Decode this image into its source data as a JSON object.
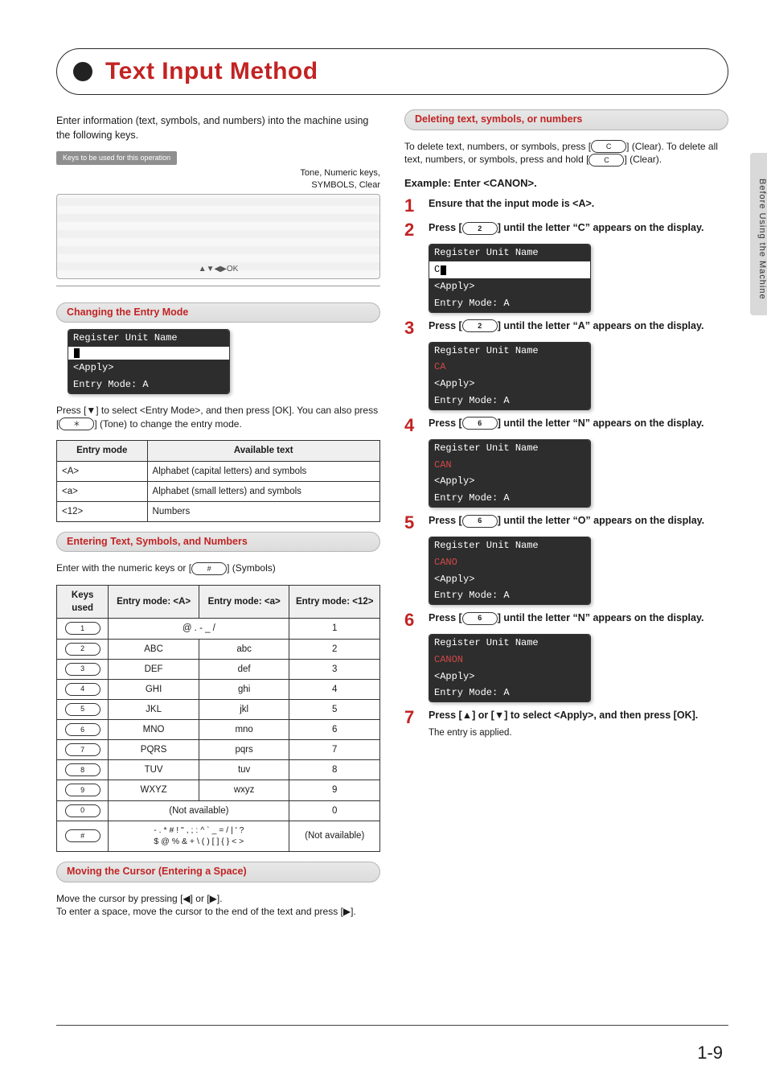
{
  "title": "Text Input Method",
  "sidetab": "Before Using the Machine",
  "pagenum": "1-9",
  "intro": "Enter information (text, symbols, and numbers) into the machine using the following keys.",
  "panel": {
    "tag": "Keys to be used for this operation",
    "small1": "Tone, Numeric keys,",
    "small2": "SYMBOLS, Clear",
    "nav": "▲▼◀▶OK"
  },
  "pill_change": "Changing the Entry Mode",
  "lcd_change": {
    "l1": "Register Unit Name",
    "l2_text": "",
    "l3": " <Apply>",
    "l4": "Entry Mode: A"
  },
  "change_note_a": "Press [▼] to select <Entry Mode>, and then press [OK]. You can also press [",
  "change_note_ast": "＊",
  "change_note_b": "] (Tone) to change the entry mode.",
  "entry_table": {
    "h1": "Entry mode",
    "h2": "Available text",
    "rows": [
      {
        "m": "<A>",
        "t": "Alphabet (capital letters) and symbols"
      },
      {
        "m": "<a>",
        "t": "Alphabet (small letters) and symbols"
      },
      {
        "m": "<12>",
        "t": "Numbers"
      }
    ]
  },
  "pill_enter": "Entering Text, Symbols, and Numbers",
  "enter_note_a": "Enter with the numeric keys or [",
  "enter_note_hash": "#",
  "enter_note_b": "] (Symbols)",
  "keypad_table": {
    "h_key": "Keys used",
    "h_A": "Entry mode: <A>",
    "h_a": "Entry mode: <a>",
    "h_12": "Entry mode: <12>",
    "rows": [
      {
        "key": "1",
        "colspan": true,
        "Aa": "@ . - _ /",
        "n": "1"
      },
      {
        "key": "2",
        "A": "ABC",
        "a": "abc",
        "n": "2"
      },
      {
        "key": "3",
        "A": "DEF",
        "a": "def",
        "n": "3"
      },
      {
        "key": "4",
        "A": "GHI",
        "a": "ghi",
        "n": "4"
      },
      {
        "key": "5",
        "A": "JKL",
        "a": "jkl",
        "n": "5"
      },
      {
        "key": "6",
        "A": "MNO",
        "a": "mno",
        "n": "6"
      },
      {
        "key": "7",
        "A": "PQRS",
        "a": "pqrs",
        "n": "7"
      },
      {
        "key": "8",
        "A": "TUV",
        "a": "tuv",
        "n": "8"
      },
      {
        "key": "9",
        "A": "WXYZ",
        "a": "wxyz",
        "n": "9"
      },
      {
        "key": "0",
        "colspan": true,
        "Aa": "(Not available)",
        "n": "0"
      },
      {
        "key": "#",
        "colspan": true,
        "Aa": "- . * # ! \" , ; : ^ ` _ = / | ' ?\n$ @ % & + \\ ( ) [ ] { } < >",
        "n": "(Not available)"
      }
    ]
  },
  "pill_cursor": "Moving the Cursor (Entering a Space)",
  "cursor_text": "Move the cursor by pressing [◀] or [▶].\nTo enter a space, move the cursor to the end of the text and press [▶].",
  "pill_delete": "Deleting text, symbols, or numbers",
  "delete_text_a": "To delete text, numbers, or symbols, press [",
  "delete_c": "C",
  "delete_text_b": "] (Clear). To delete all text, numbers, or symbols, press and hold [",
  "delete_text_c": "] (Clear).",
  "example_h": "Example: Enter <CANON>.",
  "steps": [
    {
      "n": "1",
      "text": "Ensure that the input mode is <A>."
    },
    {
      "n": "2",
      "text_a": "Press [",
      "key": "2",
      "text_b": "] until the letter “C” appears on the display.",
      "lcd": {
        "l1": "Register Unit Name",
        "l2": "C",
        "l3": " <Apply>",
        "l4": "Entry Mode: A"
      }
    },
    {
      "n": "3",
      "text_a": "Press [",
      "key": "2",
      "text_b": "] until the letter “A” appears on the display.",
      "lcd": {
        "l1": "Register Unit Name",
        "l2": "CA",
        "l3": " <Apply>",
        "l4": "Entry Mode: A"
      }
    },
    {
      "n": "4",
      "text_a": "Press [",
      "key": "6",
      "text_b": "] until the letter “N” appears on the display.",
      "lcd": {
        "l1": "Register Unit Name",
        "l2": "CAN",
        "l3": " <Apply>",
        "l4": "Entry Mode: A"
      }
    },
    {
      "n": "5",
      "text_a": "Press [",
      "key": "6",
      "text_b": "] until the letter “O” appears on the display.",
      "lcd": {
        "l1": "Register Unit Name",
        "l2": "CANO",
        "l3": " <Apply>",
        "l4": "Entry Mode: A"
      }
    },
    {
      "n": "6",
      "text_a": "Press [",
      "key": "6",
      "text_b": "] until the letter “N” appears on the display.",
      "lcd": {
        "l1": "Register Unit Name",
        "l2": "CANON",
        "l3": " <Apply>",
        "l4": "Entry Mode: A"
      }
    },
    {
      "n": "7",
      "text": "Press [▲] or [▼] to select <Apply>, and then press [OK].",
      "sub": "The entry is applied."
    }
  ]
}
